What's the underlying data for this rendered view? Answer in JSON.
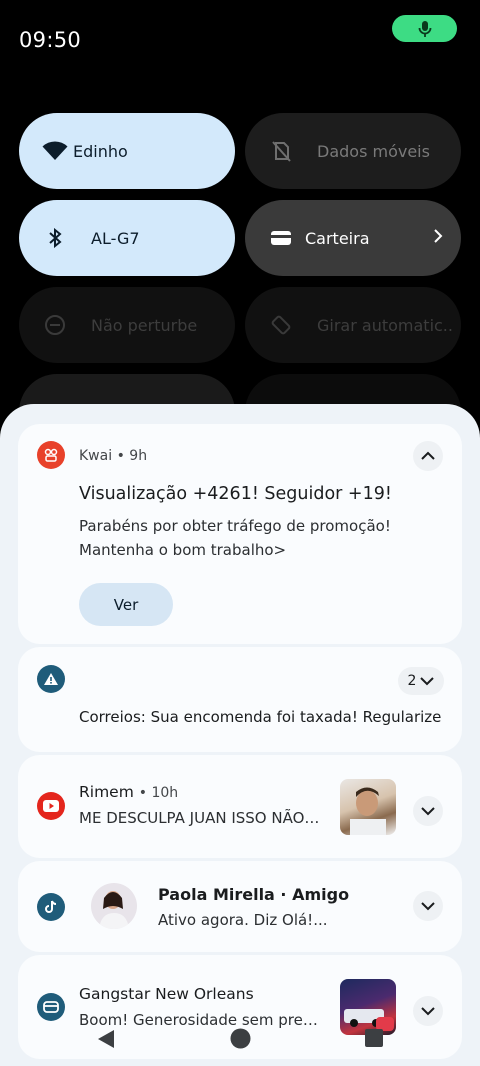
{
  "status": {
    "time": "09:50"
  },
  "tiles": [
    {
      "label": "Edinho",
      "icon": "wifi-icon"
    },
    {
      "label": "Dados móveis",
      "icon": "mobile-data-off-icon"
    },
    {
      "label": "AL-G7",
      "icon": "bluetooth-icon"
    },
    {
      "label": "Carteira",
      "icon": "wallet-icon"
    },
    {
      "label": "Não perturbe",
      "icon": "do-not-disturb-icon"
    },
    {
      "label": "Girar automatic..",
      "icon": "auto-rotate-icon"
    }
  ],
  "notifications": {
    "kwai": {
      "app": "Kwai",
      "time": "9h",
      "title": "Visualização +4261! Seguidor +19!",
      "body": "Parabéns por obter tráfego de promoção! Mantenha o bom trabalho>",
      "action": "Ver"
    },
    "correios": {
      "count": "2",
      "text": "Correios: Sua encomenda foi taxada! Regularize"
    },
    "youtube": {
      "sender": "Rimem",
      "time": "10h",
      "text": "ME DESCULPA JUAN ISSO NÃO FOI LEGAL"
    },
    "tiktok": {
      "name": "Paola Mirella · Amigo",
      "text": "Ativo agora. Diz Olá!..."
    },
    "gangstar": {
      "app": "Gangstar New Orleans",
      "text": "Boom! Generosidade sem precedentes"
    }
  },
  "colors": {
    "tile_on": "#d3e9fb",
    "kwai": "#e8412a",
    "alert": "#1f5c7a",
    "youtube": "#e4261d",
    "tiktok": "#1f5c7a",
    "gangstar": "#1f5c7a",
    "mic": "#3ddc84"
  }
}
